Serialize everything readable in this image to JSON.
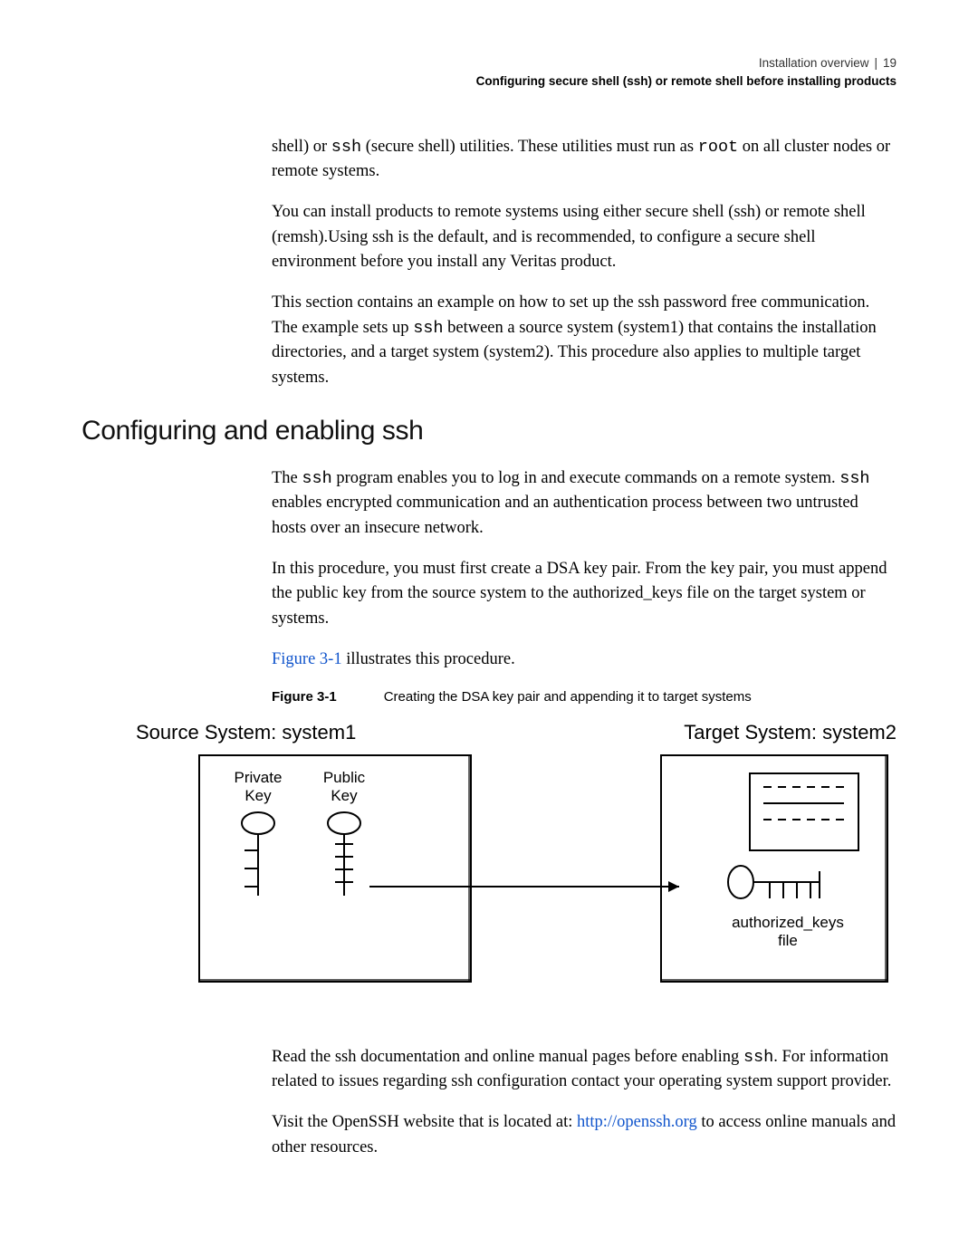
{
  "header": {
    "breadcrumb": "Installation overview",
    "page_number": "19",
    "subtitle": "Configuring secure shell (ssh) or remote shell before installing products"
  },
  "intro": {
    "p1a": "shell) or ",
    "p1_code1": "ssh",
    "p1b": " (secure shell) utilities. These utilities must run as ",
    "p1_code2": "root",
    "p1c": " on all cluster nodes or remote systems.",
    "p2": "You can install products to remote systems using either secure shell (ssh) or remote shell (remsh).Using ssh is the default, and is recommended, to configure a secure shell environment before you install any Veritas product.",
    "p3a": "This section contains an example on how to set up the ssh password free communication. The example sets up  ",
    "p3_code1": "ssh",
    "p3b": " between a source system (system1) that contains the installation directories, and a target system (system2). This procedure also applies to multiple target systems."
  },
  "section": {
    "heading": "Configuring and enabling ssh",
    "p1a": "The ",
    "p1_code1": "ssh",
    "p1b": " program enables you to log in and execute commands on a remote system. ",
    "p1_code2": "ssh",
    "p1c": "  enables encrypted communication and an authentication process between two untrusted hosts over an insecure network.",
    "p2": "In this procedure, you must first create a DSA key pair. From the key pair, you must append the public key from the source system to the authorized_keys file on the target system or systems.",
    "p3a": "Figure 3-1",
    "p3b": " illustrates this procedure.",
    "fig_label": "Figure 3-1",
    "fig_caption": "Creating the DSA key pair and appending it to target systems",
    "diagram": {
      "source_title": "Source System: system1",
      "target_title": "Target System: system2",
      "private_key": "Private\nKey",
      "public_key": "Public\nKey",
      "auth_label1": "authorized_keys",
      "auth_label2": "file"
    },
    "p4a": "Read the ssh documentation and online manual pages before enabling ",
    "p4_code1": "ssh",
    "p4b": ". For information related to issues regarding ssh configuration contact your operating system support provider.",
    "p5a": "Visit the OpenSSH website that is located at: ",
    "p5_link": "http://openssh.org",
    "p5b": " to access online manuals and other resources."
  }
}
